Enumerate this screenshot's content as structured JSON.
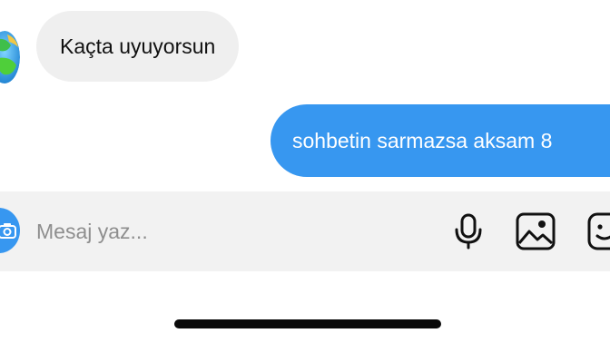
{
  "messages": [
    {
      "direction": "incoming",
      "text": "Kaçta uyuyorsun"
    },
    {
      "direction": "outgoing",
      "text": "sohbetin sarmazsa aksam 8"
    }
  ],
  "composer": {
    "placeholder": "Mesaj yaz...",
    "icons": [
      "camera-icon",
      "microphone-icon",
      "image-icon",
      "sticker-icon"
    ]
  },
  "colors": {
    "outgoing_bubble": "#3797f0",
    "incoming_bubble": "#efefef",
    "composer_background": "#f2f2f2"
  }
}
